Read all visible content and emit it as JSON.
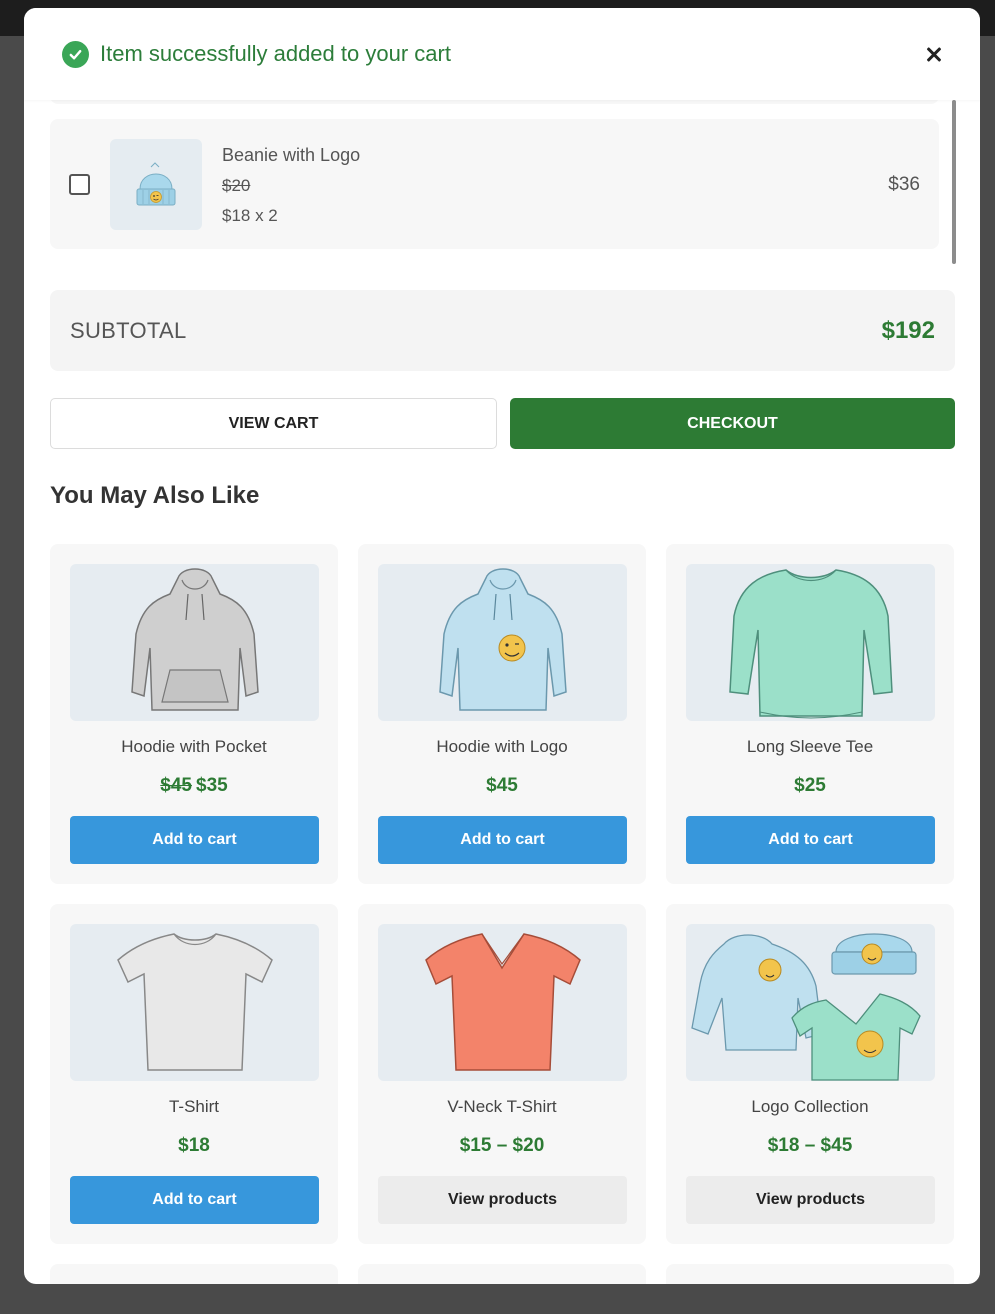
{
  "notice": {
    "text": "Item successfully added to your cart"
  },
  "cart_item": {
    "name": "Beanie with Logo",
    "old_price": "$20",
    "qty_price": "$18 x 2",
    "line_total": "$36"
  },
  "subtotal": {
    "label": "SUBTOTAL",
    "value": "$192"
  },
  "actions": {
    "view_cart": "VIEW CART",
    "checkout": "CHECKOUT"
  },
  "upsell": {
    "title": "You May Also Like",
    "products": [
      {
        "name": "Hoodie with Pocket",
        "old_price": "$45",
        "price": "$35",
        "button": "Add to cart"
      },
      {
        "name": "Hoodie with Logo",
        "old_price": "",
        "price": "$45",
        "button": "Add to cart"
      },
      {
        "name": "Long Sleeve Tee",
        "old_price": "",
        "price": "$25",
        "button": "Add to cart"
      },
      {
        "name": "T-Shirt",
        "old_price": "",
        "price": "$18",
        "button": "Add to cart"
      },
      {
        "name": "V-Neck T-Shirt",
        "old_price": "",
        "price": "$15 – $20",
        "button": "View products"
      },
      {
        "name": "Logo Collection",
        "old_price": "",
        "price": "$18 – $45",
        "button": "View products"
      }
    ]
  },
  "colors": {
    "accent_green": "#2d7b34",
    "button_blue": "#3797dc",
    "success_green": "#3aa657"
  }
}
